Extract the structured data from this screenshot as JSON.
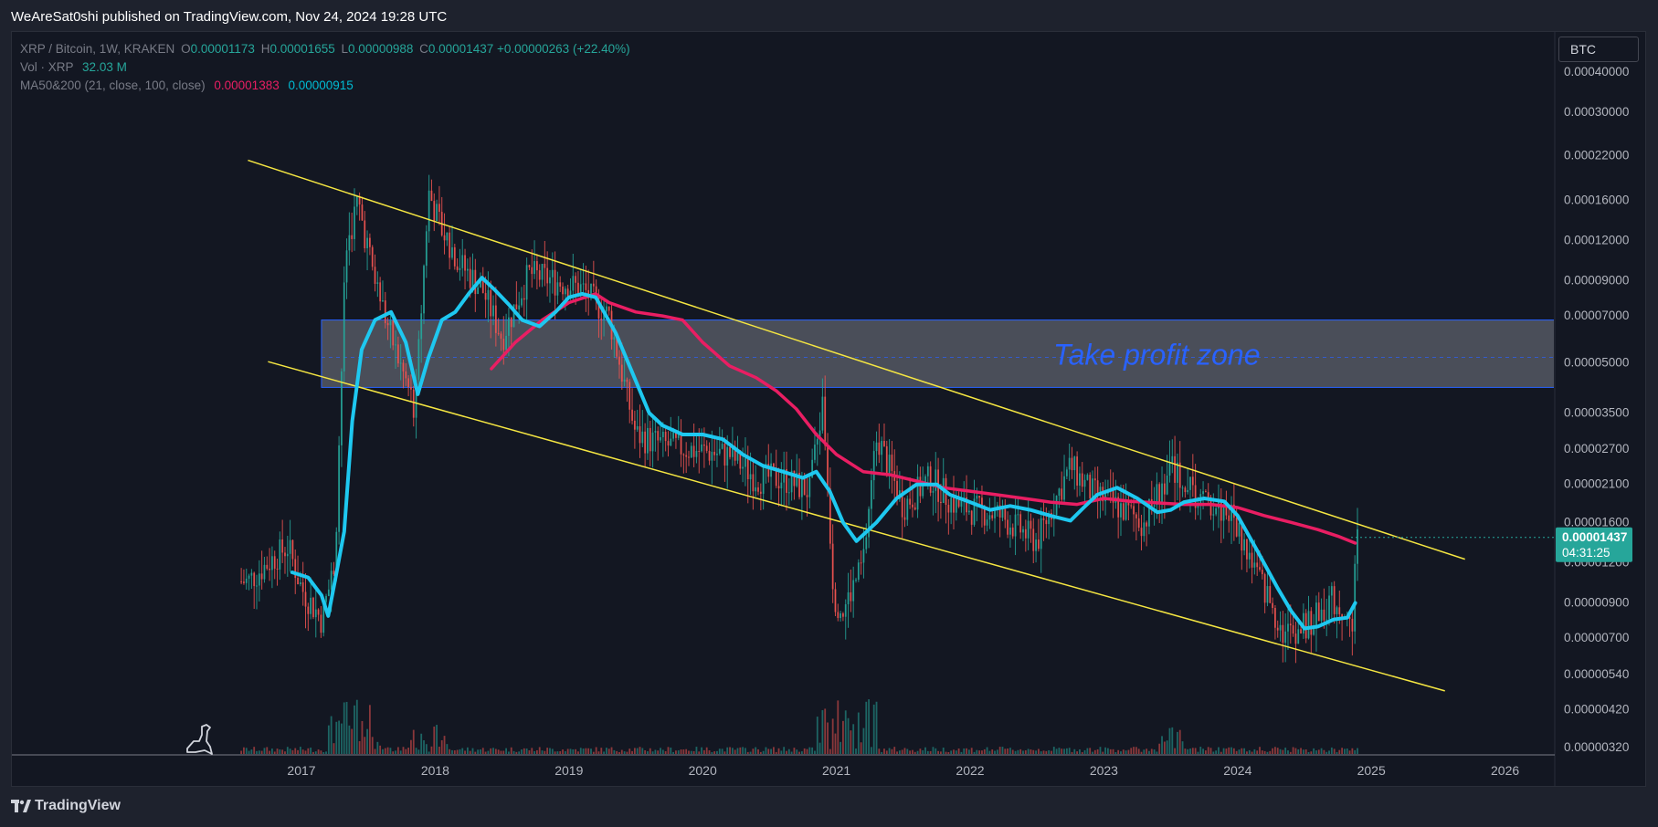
{
  "header": {
    "published": "WeAreSat0shi published on TradingView.com, Nov 24, 2024 19:28 UTC"
  },
  "legend": {
    "symbol": "XRP / Bitcoin, 1W, KRAKEN",
    "o_key": "O",
    "o_val": "0.00001173",
    "h_key": "H",
    "h_val": "0.00001655",
    "l_key": "L",
    "l_val": "0.00000988",
    "c_key": "C",
    "c_val": "0.00001437",
    "change": "+0.00000263 (+22.40%)",
    "vol_label": "Vol · XRP",
    "vol_val": "32.03 M",
    "ma_label": "MA50&200 (21, close, 100, close)",
    "ma1_val": "0.00001383",
    "ma2_val": "0.00000915"
  },
  "currency": "BTC",
  "footer": {
    "brand": "TradingView"
  },
  "colors": {
    "up": "#26a69a",
    "down": "#ef5350",
    "ma_fast": "#1ec8f0",
    "ma_slow": "#e91e63",
    "channel": "#f5e642",
    "zone_fill": "#787b86",
    "zone_text": "#2962ff"
  },
  "chart_data": {
    "type": "line",
    "y_scale": "log",
    "y_ticks": [
      "0.00040000",
      "0.00030000",
      "0.00022000",
      "0.00016000",
      "0.00012000",
      "0.00009000",
      "0.00007000",
      "0.00005000",
      "0.00003500",
      "0.00002700",
      "0.00002100",
      "0.00001600",
      "0.00001200",
      "0.00000900",
      "0.00000700",
      "0.00000540",
      "0.00000420",
      "0.00000320"
    ],
    "x_ticks": [
      "2017",
      "2018",
      "2019",
      "2020",
      "2021",
      "2022",
      "2023",
      "2024",
      "2025",
      "2026"
    ],
    "last_price": "0.00001437",
    "countdown": "04:31:25",
    "annotation": "Take profit zone",
    "zone": {
      "low": 4.2e-05,
      "high": 6.8e-05
    },
    "channel_upper": [
      [
        2016.6,
        0.000213
      ],
      [
        2025.7,
        1.23e-05
      ]
    ],
    "channel_lower": [
      [
        2016.75,
        5.05e-05
      ],
      [
        2025.55,
        4.8e-06
      ]
    ],
    "series": [
      {
        "name": "MA 21",
        "color": "#1ec8f0",
        "points": [
          [
            2016.93,
            1.12e-05
          ],
          [
            2017.05,
            1.08e-05
          ],
          [
            2017.15,
            9.5e-06
          ],
          [
            2017.2,
            8.2e-06
          ],
          [
            2017.25,
            1.05e-05
          ],
          [
            2017.32,
            1.5e-05
          ],
          [
            2017.38,
            3.3e-05
          ],
          [
            2017.45,
            5.5e-05
          ],
          [
            2017.55,
            6.8e-05
          ],
          [
            2017.67,
            7.2e-05
          ],
          [
            2017.78,
            5.8e-05
          ],
          [
            2017.87,
            4e-05
          ],
          [
            2017.95,
            5.2e-05
          ],
          [
            2018.05,
            6.8e-05
          ],
          [
            2018.15,
            7.2e-05
          ],
          [
            2018.25,
            8.2e-05
          ],
          [
            2018.35,
            9.2e-05
          ],
          [
            2018.45,
            8.4e-05
          ],
          [
            2018.55,
            7.6e-05
          ],
          [
            2018.65,
            6.8e-05
          ],
          [
            2018.78,
            6.5e-05
          ],
          [
            2018.9,
            7.2e-05
          ],
          [
            2019.0,
            8e-05
          ],
          [
            2019.1,
            8.2e-05
          ],
          [
            2019.2,
            8e-05
          ],
          [
            2019.35,
            6.2e-05
          ],
          [
            2019.5,
            4.4e-05
          ],
          [
            2019.6,
            3.5e-05
          ],
          [
            2019.7,
            3.2e-05
          ],
          [
            2019.85,
            3e-05
          ],
          [
            2020.0,
            3e-05
          ],
          [
            2020.15,
            2.9e-05
          ],
          [
            2020.3,
            2.6e-05
          ],
          [
            2020.45,
            2.4e-05
          ],
          [
            2020.6,
            2.3e-05
          ],
          [
            2020.75,
            2.2e-05
          ],
          [
            2020.85,
            2.3e-05
          ],
          [
            2020.95,
            2e-05
          ],
          [
            2021.05,
            1.6e-05
          ],
          [
            2021.15,
            1.4e-05
          ],
          [
            2021.3,
            1.6e-05
          ],
          [
            2021.45,
            1.9e-05
          ],
          [
            2021.6,
            2.1e-05
          ],
          [
            2021.75,
            2.1e-05
          ],
          [
            2021.85,
            1.95e-05
          ],
          [
            2022.0,
            1.85e-05
          ],
          [
            2022.15,
            1.75e-05
          ],
          [
            2022.3,
            1.8e-05
          ],
          [
            2022.45,
            1.75e-05
          ],
          [
            2022.6,
            1.68e-05
          ],
          [
            2022.75,
            1.62e-05
          ],
          [
            2022.85,
            1.78e-05
          ],
          [
            2022.95,
            1.95e-05
          ],
          [
            2023.1,
            2.05e-05
          ],
          [
            2023.25,
            1.9e-05
          ],
          [
            2023.4,
            1.72e-05
          ],
          [
            2023.5,
            1.75e-05
          ],
          [
            2023.6,
            1.85e-05
          ],
          [
            2023.75,
            1.9e-05
          ],
          [
            2023.9,
            1.86e-05
          ],
          [
            2024.0,
            1.68e-05
          ],
          [
            2024.15,
            1.3e-05
          ],
          [
            2024.3,
            1e-05
          ],
          [
            2024.4,
            8.5e-06
          ],
          [
            2024.5,
            7.5e-06
          ],
          [
            2024.6,
            7.6e-06
          ],
          [
            2024.72,
            8e-06
          ],
          [
            2024.82,
            8.1e-06
          ],
          [
            2024.88,
            9e-06
          ]
        ]
      },
      {
        "name": "MA 100",
        "color": "#e91e63",
        "points": [
          [
            2018.42,
            4.8e-05
          ],
          [
            2018.6,
            5.8e-05
          ],
          [
            2018.8,
            6.8e-05
          ],
          [
            2019.0,
            7.7e-05
          ],
          [
            2019.2,
            8.2e-05
          ],
          [
            2019.3,
            7.7e-05
          ],
          [
            2019.5,
            7.2e-05
          ],
          [
            2019.7,
            7e-05
          ],
          [
            2019.85,
            6.8e-05
          ],
          [
            2020.0,
            5.8e-05
          ],
          [
            2020.2,
            4.9e-05
          ],
          [
            2020.4,
            4.5e-05
          ],
          [
            2020.55,
            4.1e-05
          ],
          [
            2020.7,
            3.6e-05
          ],
          [
            2020.85,
            3e-05
          ],
          [
            2021.0,
            2.6e-05
          ],
          [
            2021.2,
            2.3e-05
          ],
          [
            2021.4,
            2.25e-05
          ],
          [
            2021.6,
            2.15e-05
          ],
          [
            2021.8,
            2.05e-05
          ],
          [
            2022.0,
            2e-05
          ],
          [
            2022.2,
            1.95e-05
          ],
          [
            2022.4,
            1.9e-05
          ],
          [
            2022.6,
            1.85e-05
          ],
          [
            2022.8,
            1.82e-05
          ],
          [
            2023.0,
            1.9e-05
          ],
          [
            2023.2,
            1.86e-05
          ],
          [
            2023.4,
            1.84e-05
          ],
          [
            2023.6,
            1.82e-05
          ],
          [
            2023.8,
            1.82e-05
          ],
          [
            2024.0,
            1.78e-05
          ],
          [
            2024.2,
            1.68e-05
          ],
          [
            2024.4,
            1.6e-05
          ],
          [
            2024.6,
            1.52e-05
          ],
          [
            2024.75,
            1.45e-05
          ],
          [
            2024.88,
            1.38e-05
          ]
        ]
      }
    ]
  }
}
